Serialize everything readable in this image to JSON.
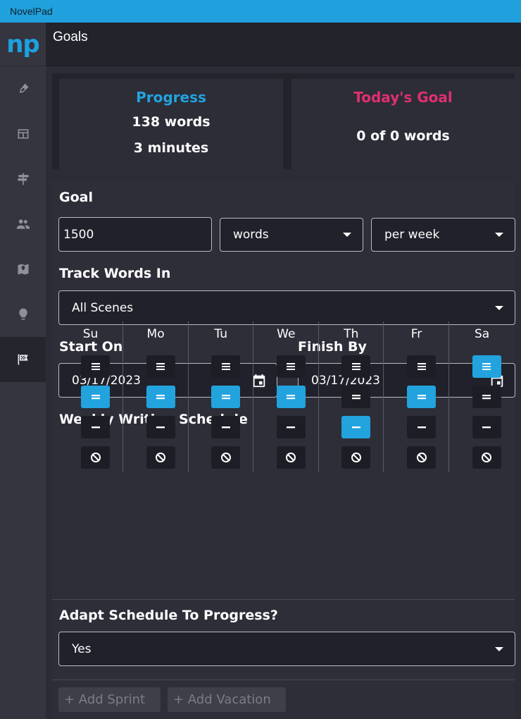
{
  "window": {
    "title": "NovelPad"
  },
  "app": {
    "logo_text": "np"
  },
  "sidebar": {
    "items": [
      {
        "icon": "pen-icon",
        "active": false
      },
      {
        "icon": "layout-icon",
        "active": false
      },
      {
        "icon": "signpost-icon",
        "active": false
      },
      {
        "icon": "people-icon",
        "active": false
      },
      {
        "icon": "map-icon",
        "active": false
      },
      {
        "icon": "lightbulb-icon",
        "active": false
      },
      {
        "icon": "checkered-flag-icon",
        "active": true
      }
    ]
  },
  "header": {
    "title": "Goals"
  },
  "stats": {
    "progress": {
      "title": "Progress",
      "words": "138 words",
      "minutes": "3 minutes",
      "color": "#22a3de"
    },
    "today": {
      "title": "Today's Goal",
      "value": "0 of 0 words",
      "color": "#e0306e"
    }
  },
  "goal": {
    "label": "Goal",
    "amount": "1500",
    "unit": "words",
    "period": "per week"
  },
  "track": {
    "label": "Track Words In",
    "value": "All Scenes"
  },
  "start": {
    "label": "Start On",
    "value": "03/17/2023"
  },
  "finish": {
    "label": "Finish By",
    "value": "03/17/2023"
  },
  "schedule": {
    "label": "Weekly Writing Schedule",
    "days": [
      {
        "name": "Su",
        "selected": 1
      },
      {
        "name": "Mo",
        "selected": 1
      },
      {
        "name": "Tu",
        "selected": 1
      },
      {
        "name": "We",
        "selected": 1
      },
      {
        "name": "Th",
        "selected": 2
      },
      {
        "name": "Fr",
        "selected": 1
      },
      {
        "name": "Sa",
        "selected": 0
      }
    ],
    "levels": [
      "three-lines-icon",
      "two-lines-icon",
      "one-line-icon",
      "none-icon"
    ]
  },
  "adapt": {
    "label": "Adapt Schedule To Progress?",
    "value": "Yes"
  },
  "actions": {
    "add_sprint": "+ Add Sprint",
    "add_vacation": "+ Add Vacation"
  },
  "colors": {
    "accent": "#22a3de",
    "pink": "#e0306e"
  }
}
